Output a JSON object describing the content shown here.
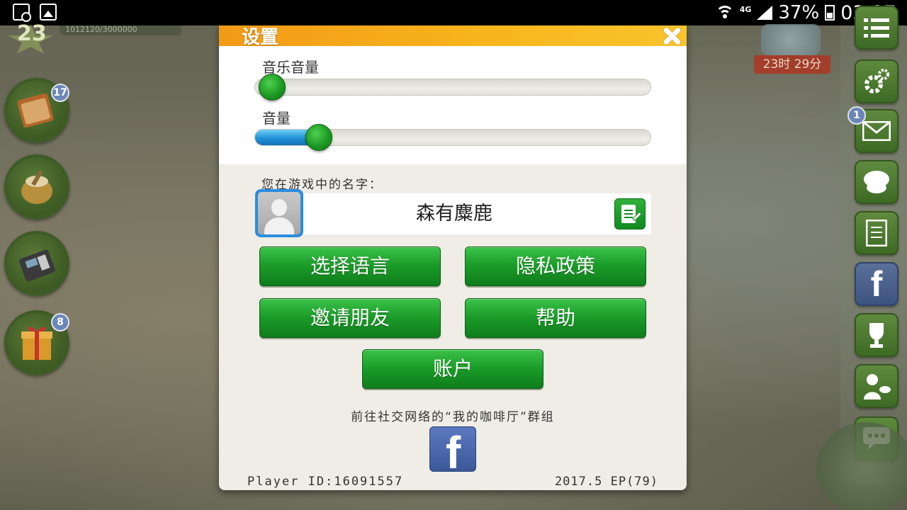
{
  "status_bar": {
    "network_type": "4G",
    "battery_percent": "37%",
    "time": "03:07"
  },
  "hud": {
    "level": "23",
    "xp_text": "1012120/3000000",
    "timer_text": "23时 29分",
    "book_badge": "17",
    "gift_badge": "8",
    "mail_badge": "1"
  },
  "dialog": {
    "title": "设置",
    "music_volume_label": "音乐音量",
    "music_volume_level": 0.0,
    "sound_volume_label": "音量",
    "sound_volume_level": 0.13,
    "name_label": "您在游戏中的名字：",
    "player_name": "森有麋鹿",
    "buttons": {
      "language": "选择语言",
      "privacy": "隐私政策",
      "invite": "邀请朋友",
      "help": "帮助",
      "account": "账户"
    },
    "social_text": "前往社交网络的“我的咖啡厅”群组",
    "player_id": "Player ID:16091557",
    "version": "2017.5 EP(79)"
  },
  "colors": {
    "header_orange": "#f5a61a",
    "button_green": "#1a9a28",
    "slider_blue": "#1f8fd6",
    "facebook_blue": "#3b5998"
  }
}
